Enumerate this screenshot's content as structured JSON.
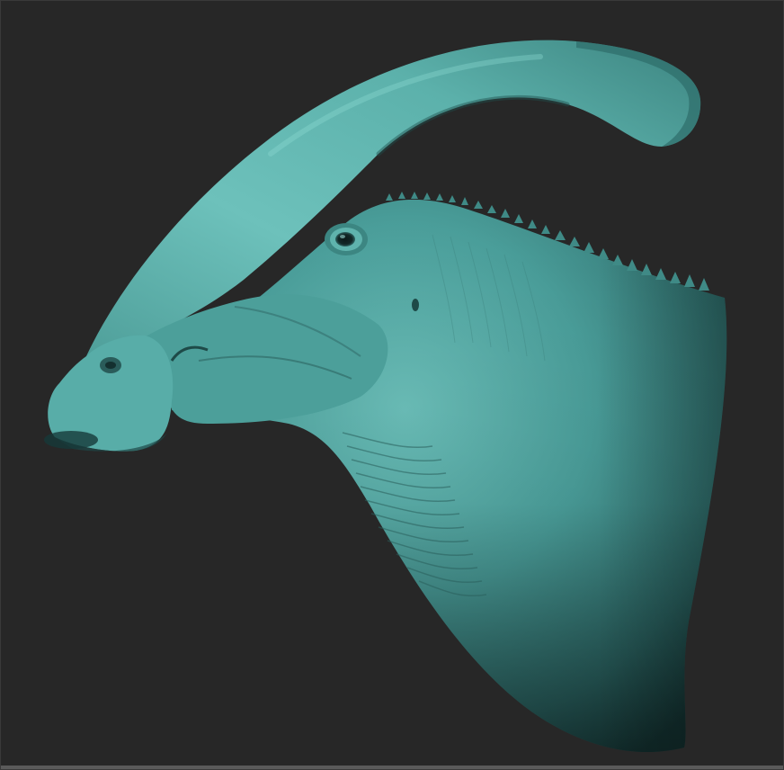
{
  "viewport": {
    "background": "#272727"
  },
  "model": {
    "subject": "parasaurolophus-head-sculpt",
    "base_color": "#4fa3a0",
    "highlight_color": "#7fd0c9",
    "shadow_color": "#1f4d4c"
  }
}
